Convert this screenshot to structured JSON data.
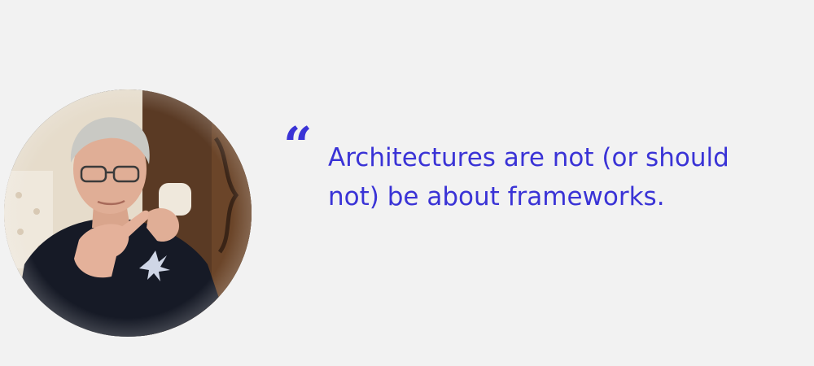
{
  "colors": {
    "background": "#f2f2f2",
    "quote_text": "#3a33d6",
    "quote_mark": "#3a33d6"
  },
  "portrait": {
    "icon": "person-portrait-photo",
    "shape": "circle"
  },
  "quote": {
    "mark": "“",
    "text": "Architectures are not (or should not) be about frameworks."
  }
}
